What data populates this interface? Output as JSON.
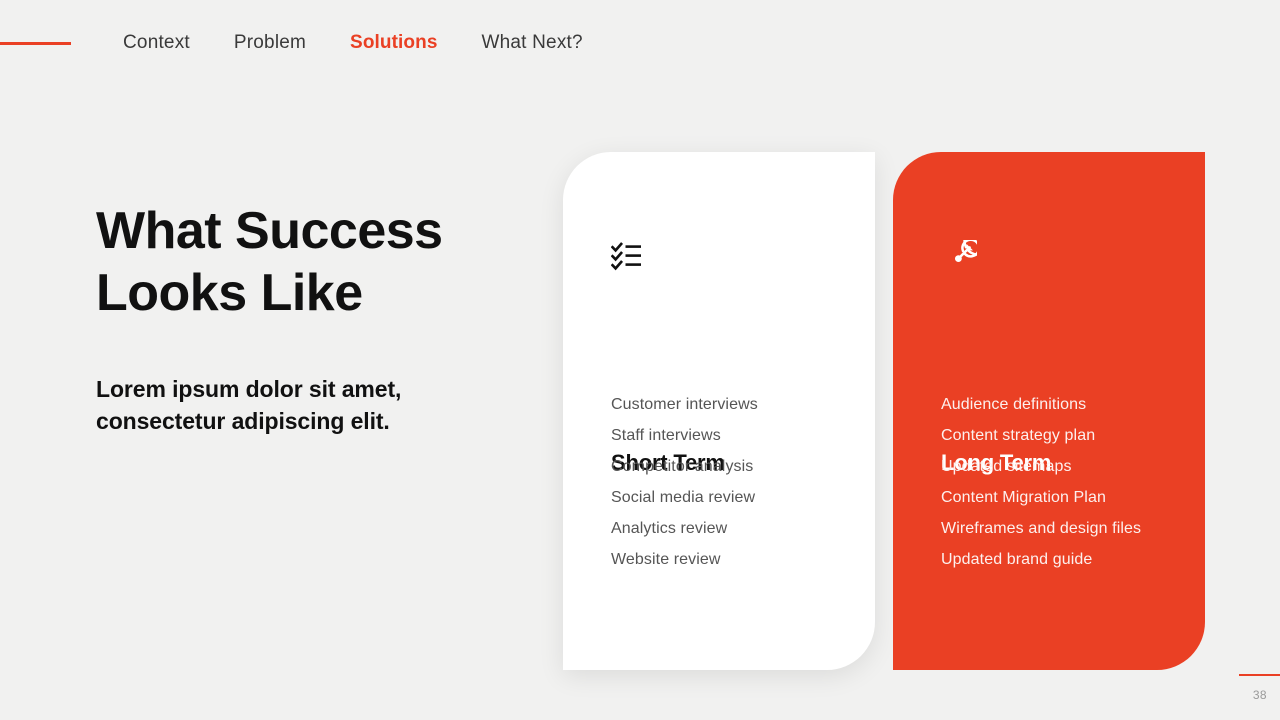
{
  "nav": {
    "rule_color": "#ea4024",
    "items": [
      {
        "label": "Context",
        "active": false
      },
      {
        "label": "Problem",
        "active": false
      },
      {
        "label": "Solutions",
        "active": true
      },
      {
        "label": "What Next?",
        "active": false
      }
    ]
  },
  "left": {
    "headline_line1": "What Success",
    "headline_line2": "Looks Like",
    "subhead_line1": "Lorem ipsum dolor sit amet,",
    "subhead_line2": "consectetur adipiscing elit."
  },
  "cards": [
    {
      "id": "short-term",
      "icon": "checklist-icon",
      "title": "Short Term",
      "background": "#ffffff",
      "text_color": "#555555",
      "items": [
        "Customer interviews",
        "Staff interviews",
        "Competitor analysis",
        "Social media review",
        "Analytics review",
        "Website review"
      ]
    },
    {
      "id": "long-term",
      "icon": "target-arrow-icon",
      "title": "Long Term",
      "background": "#ea4024",
      "text_color": "#fdf0ee",
      "items": [
        "Audience definitions",
        "Content strategy plan",
        "Updated sitemaps",
        "Content Migration Plan",
        "Wireframes and design files",
        "Updated brand guide"
      ]
    }
  ],
  "footer": {
    "page_number": "38",
    "rule_color": "#ea4024"
  },
  "theme": {
    "background": "#f1f1f0",
    "accent": "#ea4024",
    "heading": "#111111",
    "nav_text": "#3a3a3a"
  }
}
